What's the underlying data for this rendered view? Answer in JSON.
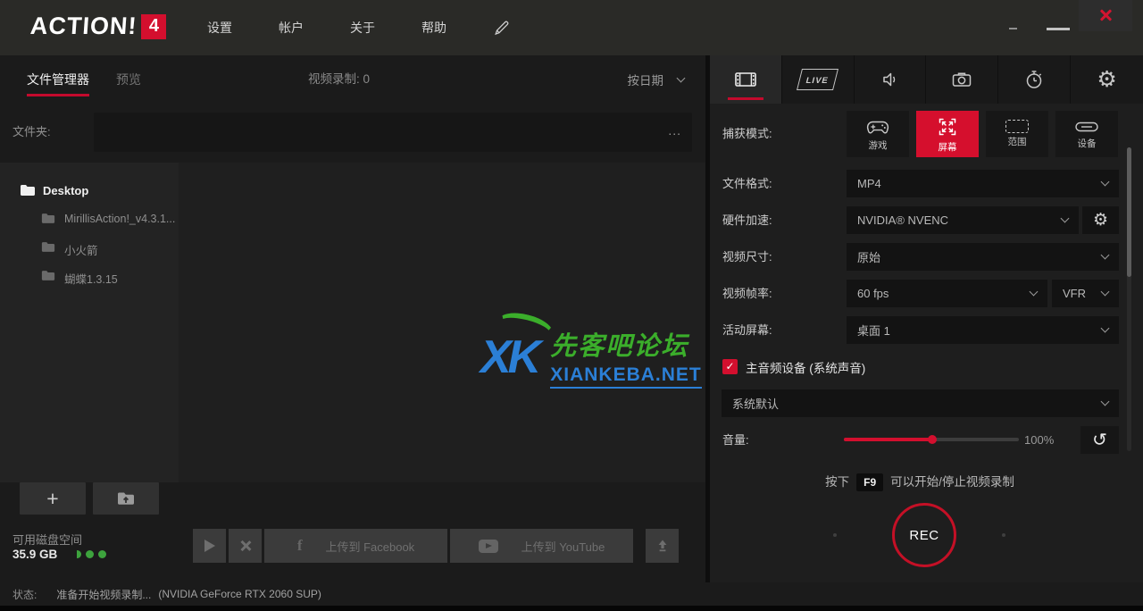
{
  "titlebar": {
    "logo_text": "ACTION!",
    "logo_badge": "4",
    "menu": [
      "设置",
      "帐户",
      "关于",
      "帮助"
    ]
  },
  "left": {
    "tab_file_manager": "文件管理器",
    "tab_preview": "预览",
    "recordings_label": "视频录制:  0",
    "sort_by": "按日期",
    "folder_label": "文件夹:",
    "browse_label": "...",
    "tree": [
      {
        "name": "Desktop"
      },
      {
        "name": "MirillisAction!_v4.3.1..."
      },
      {
        "name": "小火箭"
      },
      {
        "name": "蝴蝶1.3.15"
      }
    ],
    "add_label": "+",
    "disk_label": "可用磁盘空间",
    "disk_value": "35.9 GB",
    "facebook_icon_letter": "f",
    "upload_facebook": "上传到 Facebook",
    "upload_youtube": "上传到 YouTube"
  },
  "watermark": {
    "logo": "XK",
    "title": "先客吧论坛",
    "url": "XIANKEBA.NET"
  },
  "right": {
    "live_label": "LIVE",
    "capture": {
      "label": "捕获模式:",
      "modes": [
        {
          "label": "游戏"
        },
        {
          "label": "屏幕"
        },
        {
          "label": "范围"
        },
        {
          "label": "设备"
        }
      ],
      "active": "屏幕"
    },
    "settings": {
      "file_format": {
        "label": "文件格式:",
        "value": "MP4"
      },
      "hw_accel": {
        "label": "硬件加速:",
        "value": "NVIDIA® NVENC"
      },
      "video_size": {
        "label": "视频尺寸:",
        "value": "原始"
      },
      "framerate": {
        "label": "视频帧率:",
        "value": "60 fps",
        "mode": "VFR"
      },
      "active_screen": {
        "label": "活动屏幕:",
        "value": "桌面 1"
      }
    },
    "audio": {
      "primary_device_label": "主音频设备 (系统声音)",
      "primary_device_checked": true,
      "check_glyph": "✓",
      "device": "系统默认",
      "volume_label": "音量:",
      "volume_value": "100%",
      "reset_glyph": "↺"
    },
    "record_hint": {
      "prefix": "按下",
      "key": "F9",
      "suffix": "可以开始/停止视频录制"
    },
    "rec_button": "REC"
  },
  "statusbar": {
    "label": "状态:",
    "message": "准备开始视频录制...",
    "gpu": "(NVIDIA GeForce RTX 2060 SUP)"
  },
  "colors": {
    "accent_red": "#d30f2e",
    "disk_green": "#3da33d",
    "watermark_green": "#3bae2b",
    "watermark_blue": "#2b7fd6"
  }
}
